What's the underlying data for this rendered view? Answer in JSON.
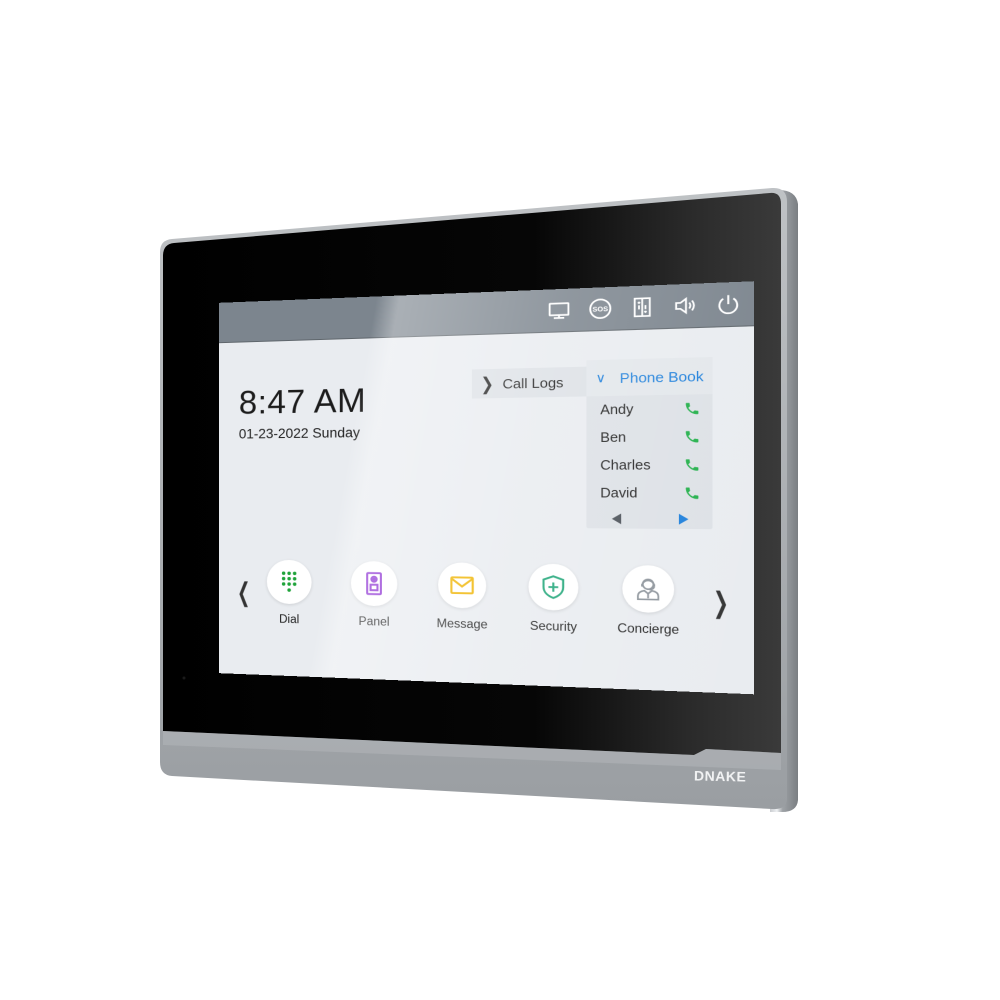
{
  "device": {
    "brand": "DNAKE",
    "colors": {
      "bezel": "#000000",
      "frame": "#a9adb1",
      "frame_edge": "#7d8185",
      "screen_bg": "#e9ecf0",
      "statusbar_bg": "#7c858e",
      "accent_blue": "#1d7fdb",
      "phone_green": "#22b04a"
    }
  },
  "statusbar": {
    "icons": [
      {
        "name": "monitor-icon",
        "label": "Monitor"
      },
      {
        "name": "sos-icon",
        "label": "SOS"
      },
      {
        "name": "unlock-door-icon",
        "label": "Unlock"
      },
      {
        "name": "volume-icon",
        "label": "Volume"
      },
      {
        "name": "power-icon",
        "label": "Power"
      }
    ]
  },
  "clock": {
    "time": "8:47 AM",
    "date": "01-23-2022 Sunday"
  },
  "call_logs": {
    "label": "Call Logs",
    "expanded": false
  },
  "phone_book": {
    "label": "Phone Book",
    "expanded": true,
    "contacts": [
      {
        "name": "Andy"
      },
      {
        "name": "Ben"
      },
      {
        "name": "Charles"
      },
      {
        "name": "David"
      }
    ]
  },
  "dock": {
    "apps": [
      {
        "id": "dial",
        "label": "Dial",
        "icon": "dialpad-icon",
        "color": "#1fa33a"
      },
      {
        "id": "panel",
        "label": "Panel",
        "icon": "door-station-icon",
        "color": "#8a2bd2"
      },
      {
        "id": "message",
        "label": "Message",
        "icon": "envelope-icon",
        "color": "#f0b400"
      },
      {
        "id": "security",
        "label": "Security",
        "icon": "shield-plus-icon",
        "color": "#22a77a"
      },
      {
        "id": "concierge",
        "label": "Concierge",
        "icon": "concierge-icon",
        "color": "#8e959c"
      }
    ]
  }
}
